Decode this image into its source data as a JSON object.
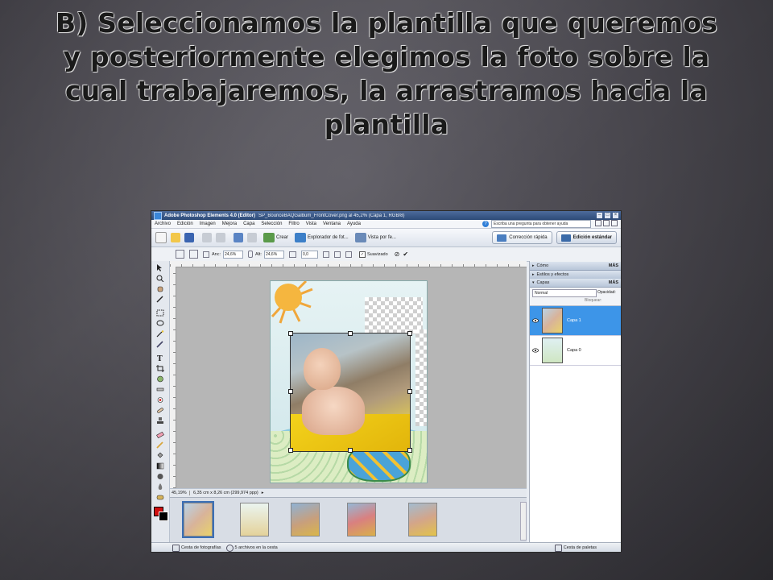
{
  "slide": {
    "title": "B) Seleccionamos la plantilla que queremos y posteriormente elegimos la foto sobre la cual trabajaremos, la arrastramos hacia la plantilla"
  },
  "window": {
    "app_name": "Adobe Photoshop Elements 4.0 (Editor)",
    "doc_name": "SP_BounceBAQGalbum_FrontCover.png al 45,2% (Capa 1, RGB/8)"
  },
  "menu": {
    "items": [
      "Archivo",
      "Edición",
      "Imagen",
      "Mejora",
      "Capa",
      "Selección",
      "Filtro",
      "Vista",
      "Ventana",
      "Ayuda"
    ],
    "help_placeholder": "Escriba una pregunta para obtener ayuda"
  },
  "shortcuts": {
    "create": "Crear",
    "photo_browser": "Explorador de fot...",
    "view_by": "Vista por fe...",
    "quick_fix": "Corrección rápida",
    "standard_edit": "Edición estándar"
  },
  "options": {
    "width_label": "Anc:",
    "width_value": "24,6%",
    "height_label": "Alt:",
    "height_value": "24,6%",
    "angle_value": "0,0",
    "smooth_label": "Suavizado"
  },
  "status": {
    "zoom": "45,19%",
    "doc_info": "6,35 cm x 8,26 cm (299,974 ppp)"
  },
  "palettes": {
    "how_to": "Cómo",
    "styles": "Estilos y efectos",
    "layers": "Capas",
    "more": "MÁS",
    "blend_mode": "Normal",
    "opacity_label": "Opacidad:",
    "lock_label": "Bloquear:",
    "layer1": "Capa 1",
    "layer0": "Capa 0"
  },
  "bottom": {
    "photo_bin": "Cesta de fotografías",
    "files_in_bin": "5 archivos en la cesta",
    "palette_bin": "Cesta de paletas"
  },
  "colors": {
    "foreground": "#d01010",
    "background": "#000000",
    "active_layer": "#3d95e8"
  }
}
